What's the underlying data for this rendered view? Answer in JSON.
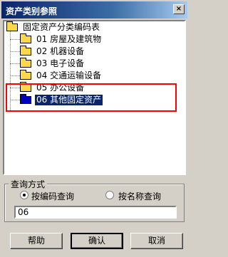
{
  "window": {
    "title": "资产类别参照",
    "close_glyph": "×"
  },
  "tree": {
    "root": {
      "label": "固定资产分类编码表",
      "icon": "folder-open-icon"
    },
    "items": [
      {
        "label": "01  房屋及建筑物",
        "icon": "folder-icon"
      },
      {
        "label": "02  机器设备",
        "icon": "folder-icon"
      },
      {
        "label": "03  电子设备",
        "icon": "folder-icon"
      },
      {
        "label": "04  交通运输设备",
        "icon": "folder-icon"
      },
      {
        "label": "05  办公设备",
        "icon": "folder-icon"
      },
      {
        "label": "06  其他固定资产",
        "icon": "folder-icon",
        "selected": true
      }
    ]
  },
  "query": {
    "group_title": "查询方式",
    "by_code_label": "按编码查询",
    "by_name_label": "按名称查询",
    "selected_mode": "code",
    "value": "06"
  },
  "buttons": {
    "help": "帮助",
    "ok": "确认",
    "cancel": "取消"
  },
  "colors": {
    "highlight_box": "#ff0000",
    "selection": "#0a246a"
  }
}
